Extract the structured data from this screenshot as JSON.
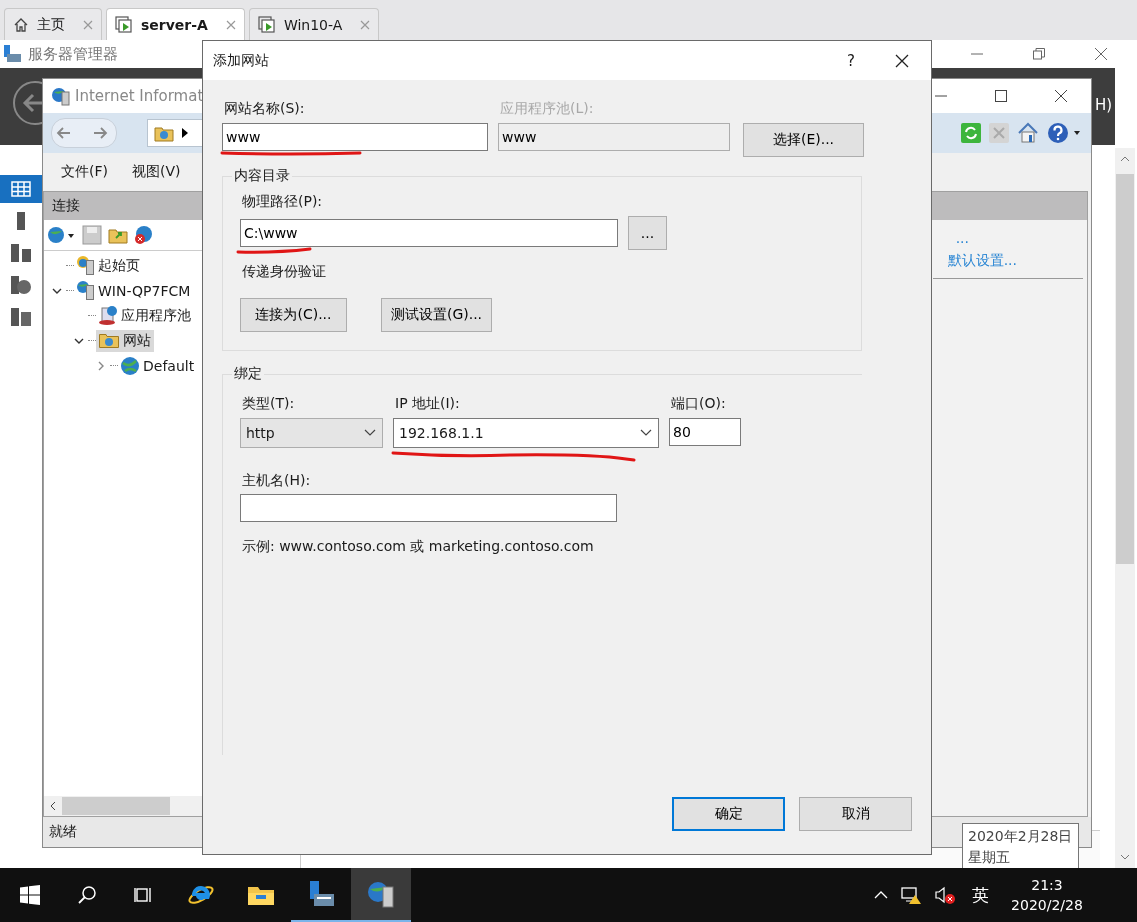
{
  "browser_tabs": [
    {
      "label": "主页",
      "selected": false
    },
    {
      "label": "server-A",
      "selected": true
    },
    {
      "label": "Win10-A",
      "selected": false
    }
  ],
  "server_manager": {
    "title": "服务器管理器",
    "header_fragment": "H)",
    "nav": [
      {
        "selected": true
      },
      {
        "selected": false
      },
      {
        "selected": false
      },
      {
        "selected": false
      },
      {
        "selected": false
      }
    ]
  },
  "iis": {
    "title": "Internet Informat",
    "menu": [
      "文件(F)",
      "视图(V)"
    ],
    "connections": {
      "title": "连接",
      "tree": [
        {
          "label": "起始页",
          "kind": "start",
          "selected": false
        },
        {
          "label": "WIN-QP7FCM",
          "kind": "server",
          "expanded": true,
          "selected": false,
          "children": [
            {
              "label": "应用程序池",
              "kind": "pool",
              "selected": false
            },
            {
              "label": "网站",
              "kind": "folder",
              "expanded": true,
              "selected": true,
              "children": [
                {
                  "label": "Default",
                  "kind": "site",
                  "expanded": false,
                  "selected": false
                }
              ]
            }
          ]
        }
      ]
    },
    "actions": [
      "...",
      "默认设置..."
    ],
    "status": "就绪"
  },
  "dialog": {
    "title": "添加网站",
    "help": "?",
    "site_name": {
      "label": "网站名称(S):",
      "value": "www",
      "highlighted": true
    },
    "app_pool": {
      "label": "应用程序池(L):",
      "value": "www",
      "disabled": true
    },
    "select_button": "选择(E)...",
    "content_dir": {
      "legend": "内容目录",
      "path_label": "物理路径(P):",
      "path_value": "C:\\www",
      "path_highlighted": true,
      "browse_button": "...",
      "auth_label": "传递身份验证",
      "connect_button": "连接为(C)...",
      "test_button": "测试设置(G)..."
    },
    "binding": {
      "legend": "绑定",
      "type": {
        "label": "类型(T):",
        "value": "http"
      },
      "ip": {
        "label": "IP 地址(I):",
        "value": "192.168.1.1",
        "highlighted": true
      },
      "port": {
        "label": "端口(O):",
        "value": "80"
      },
      "host": {
        "label": "主机名(H):"
      },
      "example": "示例: www.contoso.com 或 marketing.contoso.com"
    },
    "buttons": [
      {
        "label": "确定",
        "default": true
      },
      {
        "label": "取消",
        "default": false
      }
    ]
  },
  "tooltip": [
    "2020年2月28日",
    "星期五"
  ],
  "taskbar": {
    "apps": [
      {
        "kind": "ie",
        "running": false,
        "active": false
      },
      {
        "kind": "explorer",
        "running": false,
        "active": false
      },
      {
        "kind": "server-manager",
        "running": true,
        "active": false
      },
      {
        "kind": "iis",
        "running": true,
        "active": true
      }
    ],
    "ime": "英",
    "time": "21:3",
    "date": "2020/2/28"
  }
}
